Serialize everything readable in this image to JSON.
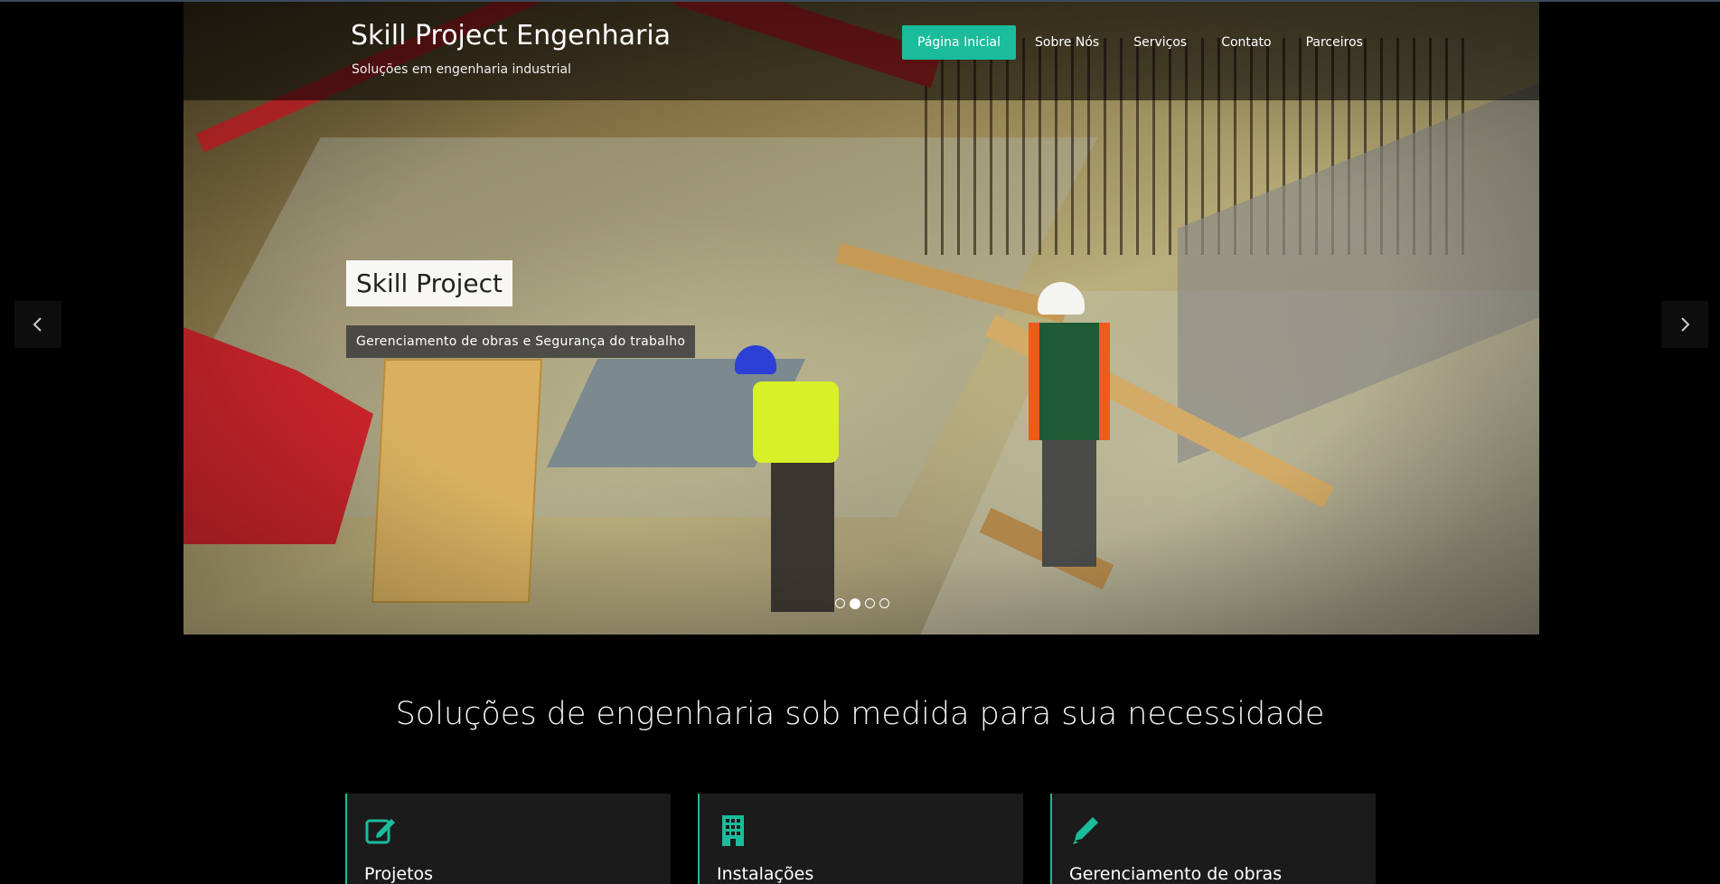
{
  "brand": {
    "title": "Skill Project Engenharia",
    "subtitle": "Soluções em engenharia industrial"
  },
  "nav": {
    "items": [
      {
        "label": "Página Inicial",
        "active": true
      },
      {
        "label": "Sobre Nós",
        "active": false
      },
      {
        "label": "Serviços",
        "active": false
      },
      {
        "label": "Contato",
        "active": false
      },
      {
        "label": "Parceiros",
        "active": false
      }
    ]
  },
  "slider": {
    "caption_title": "Skill Project",
    "caption_subtitle": "Gerenciamento de obras e Segurança do trabalho",
    "slide_count": 4,
    "active_slide": 2,
    "prev_icon": "chevron-left-icon",
    "next_icon": "chevron-right-icon"
  },
  "main": {
    "heading": "Soluções de engenharia sob medida para sua necessidade"
  },
  "cards": [
    {
      "title": "Projetos",
      "icon": "edit-icon"
    },
    {
      "title": "Instalações",
      "icon": "building-icon"
    },
    {
      "title": "Gerenciamento de obras",
      "icon": "pencil-icon"
    }
  ],
  "colors": {
    "accent": "#1abc9c",
    "background": "#000000",
    "card_background": "#1b1b1b"
  }
}
